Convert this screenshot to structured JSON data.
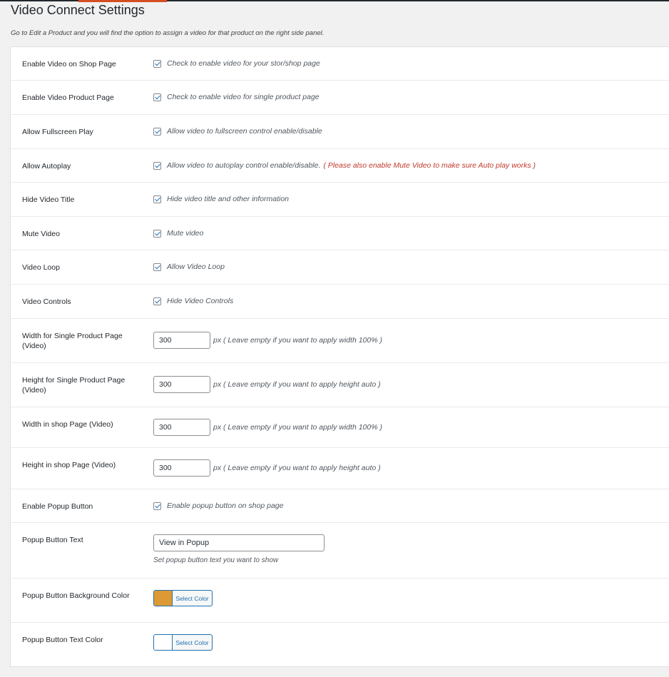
{
  "page": {
    "title": "Video Connect Settings",
    "description": "Go to Edit a Product and you will find the option to assign a video for that product on the right side panel."
  },
  "settings": {
    "enable_shop": {
      "label": "Enable Video on Shop Page",
      "desc": "Check to enable video for your stor/shop page",
      "checked": true
    },
    "enable_product": {
      "label": "Enable Video Product Page",
      "desc": "Check to enable video for single product page",
      "checked": true
    },
    "fullscreen": {
      "label": "Allow Fullscreen Play",
      "desc": "Allow video to fullscreen control enable/disable",
      "checked": true
    },
    "autoplay": {
      "label": "Allow Autoplay",
      "desc": "Allow video to autoplay control enable/disable.",
      "warning": "( Please also enable Mute Video to make sure Auto play works )",
      "checked": true
    },
    "hide_title": {
      "label": "Hide Video Title",
      "desc": "Hide video title and other information",
      "checked": true
    },
    "mute": {
      "label": "Mute Video",
      "desc": "Mute video",
      "checked": true
    },
    "loop": {
      "label": "Video Loop",
      "desc": "Allow Video Loop",
      "checked": true
    },
    "controls": {
      "label": "Video Controls",
      "desc": "Hide Video Controls",
      "checked": true
    },
    "width_single": {
      "label": "Width for Single Product Page (Video)",
      "value": "300",
      "unit": "px",
      "hint": "( Leave empty if you want to apply width 100% )"
    },
    "height_single": {
      "label": "Height for Single Product Page (Video)",
      "value": "300",
      "unit": "px",
      "hint": "( Leave empty if you want to apply height auto )"
    },
    "width_shop": {
      "label": "Width in shop Page (Video)",
      "value": "300",
      "unit": "px",
      "hint": "( Leave empty if you want to apply width 100% )"
    },
    "height_shop": {
      "label": "Height in shop Page (Video)",
      "value": "300",
      "unit": "px",
      "hint": "( Leave empty if you want to apply height auto )"
    },
    "popup_enable": {
      "label": "Enable Popup Button",
      "desc": "Enable popup button on shop page",
      "checked": true
    },
    "popup_text": {
      "label": "Popup Button Text",
      "value": "View in Popup",
      "desc": "Set popup button text you want to show"
    },
    "popup_bg": {
      "label": "Popup Button Background Color",
      "button": "Select Color",
      "color": "#dd9933"
    },
    "popup_color": {
      "label": "Popup Button Text Color",
      "button": "Select Color",
      "color": "#ffffff"
    }
  }
}
